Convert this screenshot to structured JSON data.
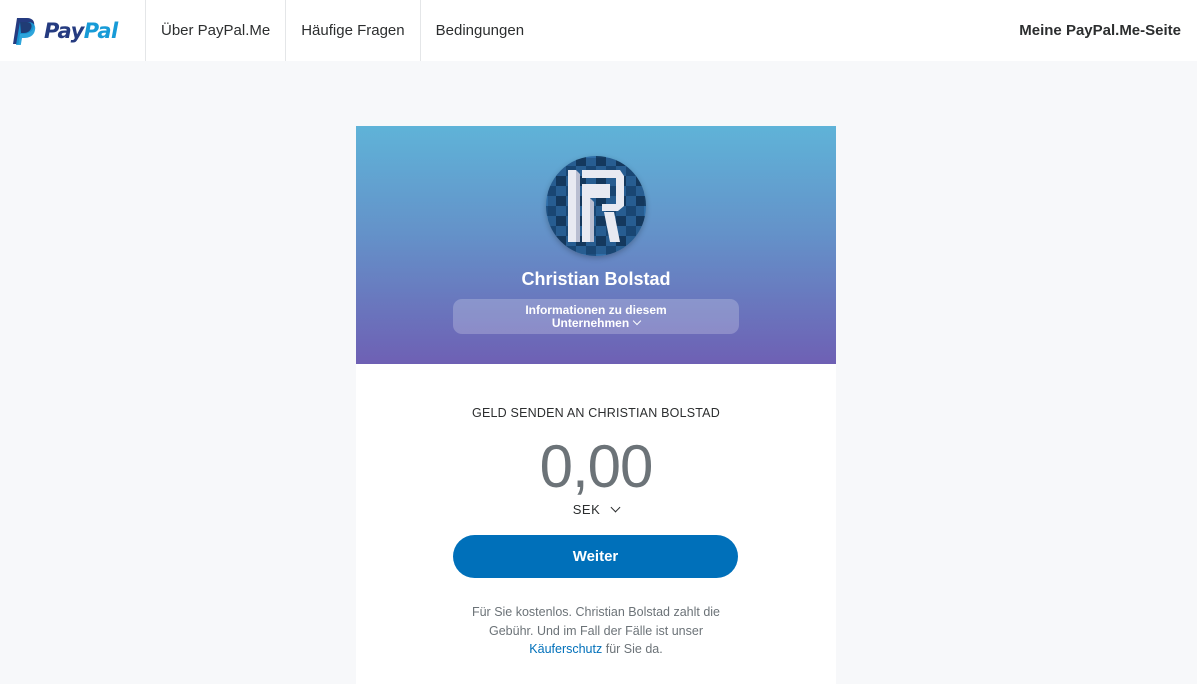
{
  "header": {
    "logo_pay": "Pay",
    "logo_pal": "Pal",
    "nav": [
      {
        "label": "Über PayPal.Me"
      },
      {
        "label": "Häufige Fragen"
      },
      {
        "label": "Bedingungen"
      }
    ],
    "my_page": "Meine PayPal.Me-Seite"
  },
  "merchant": {
    "name": "Christian Bolstad",
    "info_line1": "Informationen zu diesem",
    "info_line2": "Unternehmen"
  },
  "payment": {
    "send_label": "GELD SENDEN AN CHRISTIAN BOLSTAD",
    "amount": "0,00",
    "currency": "SEK",
    "continue_label": "Weiter",
    "fee_text_before": "Für Sie kostenlos. Christian Bolstad zahlt die Gebühr. Und im Fall der Fälle ist unser",
    "buyer_protection_link": "Käuferschutz",
    "fee_text_after": "für Sie da."
  },
  "colors": {
    "brand_blue": "#0070ba",
    "logo_dark": "#253b80",
    "logo_light": "#179bd7"
  },
  "icons": {
    "logo": "paypal-logo-icon",
    "avatar": "merchant-avatar-icon",
    "chevron": "chevron-down-icon"
  }
}
